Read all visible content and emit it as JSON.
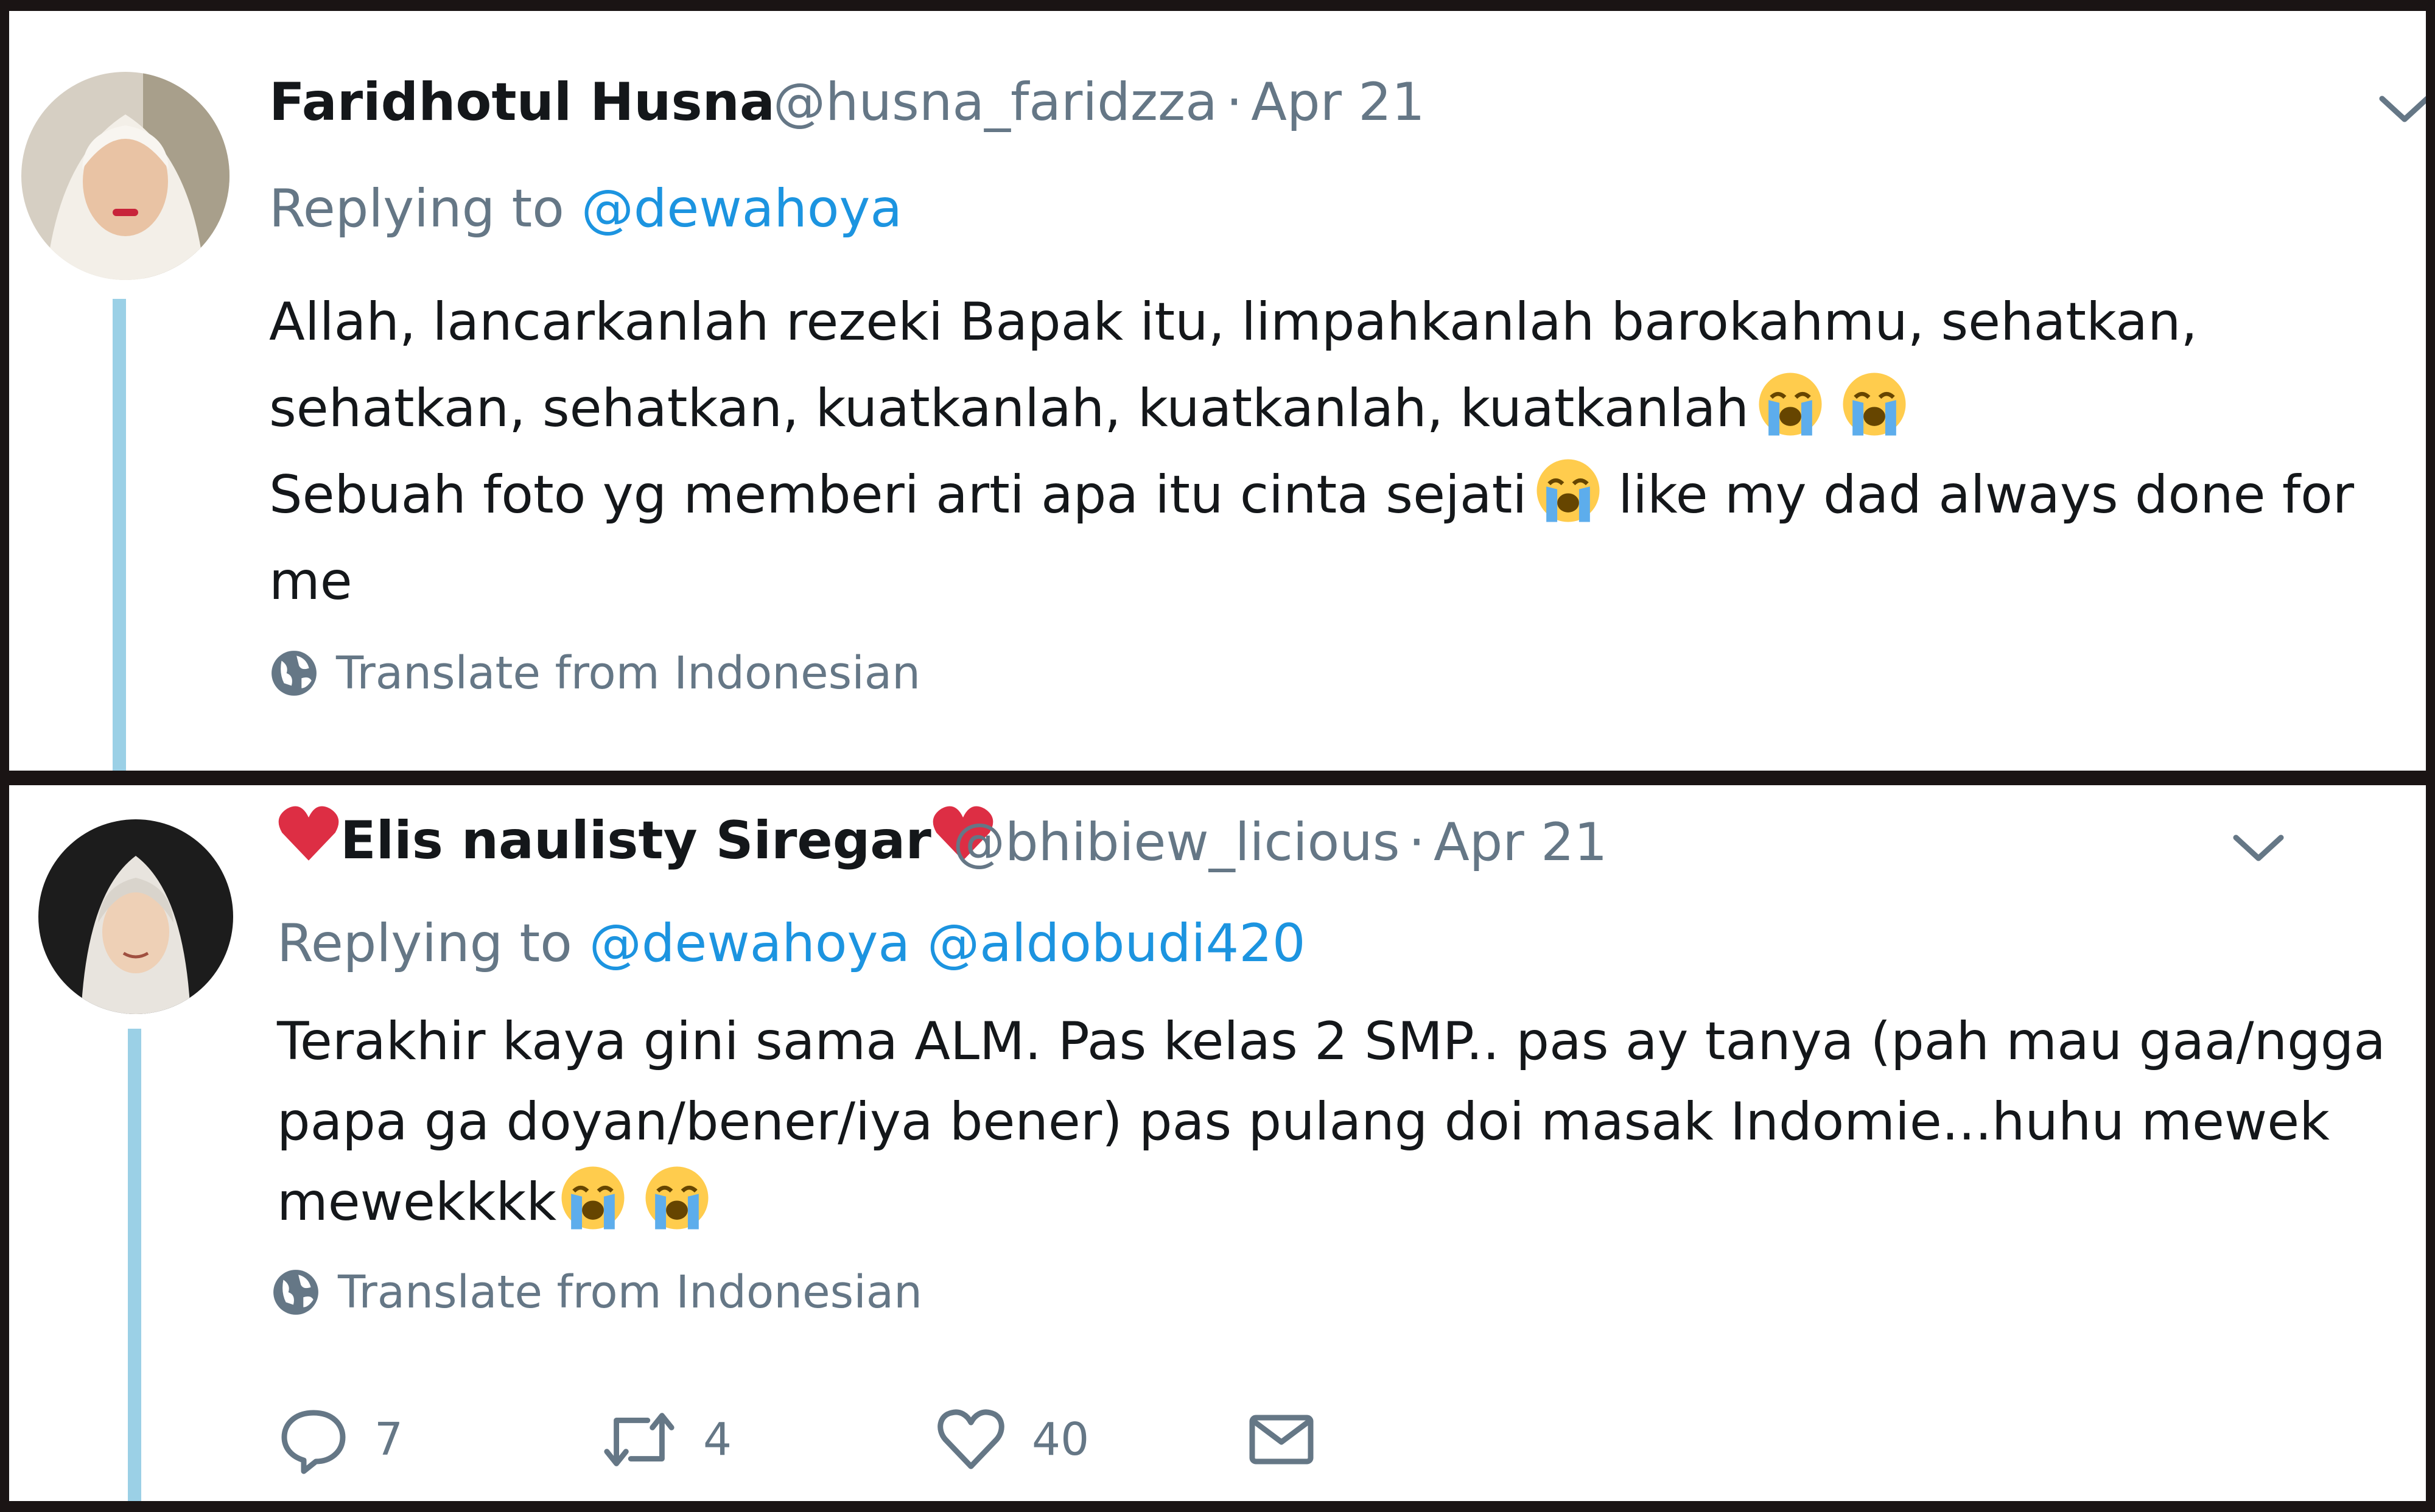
{
  "tweets": [
    {
      "display_name": "Faridhotul Husna",
      "handle": "@husna_faridzza",
      "date": "Apr 21",
      "replying_label": "Replying to",
      "mentions": [
        "@dewahoya"
      ],
      "body_lines": [
        "Allah, lancarkanlah rezeki Bapak itu, limpahkanlah barokahmu, sehatkan,",
        "sehatkan, sehatkan, kuatkanlah, kuatkanlah, kuatkanlah",
        "Sebuah foto yg memberi arti apa itu cinta sejati",
        "like my dad always done for",
        "me"
      ],
      "translate_label": "Translate from Indonesian"
    },
    {
      "display_name": "Elis naulisty Siregar",
      "handle": "@bhibiew_licious",
      "date": "Apr 21",
      "replying_label": "Replying to",
      "mentions": [
        "@dewahoya",
        "@aldobudi420"
      ],
      "body_lines": [
        "Terakhir kaya gini sama ALM. Pas kelas 2 SMP.. pas ay tanya (pah mau gaa/ngga",
        "papa ga doyan/bener/iya bener) pas pulang doi masak Indomie...huhu mewek",
        "mewekkkk"
      ],
      "translate_label": "Translate from Indonesian",
      "actions": {
        "replies": "7",
        "retweets": "4",
        "likes": "40"
      }
    }
  ],
  "icons": {
    "emoji": "loudly-crying-face",
    "menu": "chevron-down-icon",
    "globe": "globe-icon",
    "decoration": "red-heart"
  },
  "colors": {
    "link": "#1c94e0",
    "secondary_text": "#657786",
    "thread_line": "#9bd0e6",
    "border": "#1a1414"
  }
}
